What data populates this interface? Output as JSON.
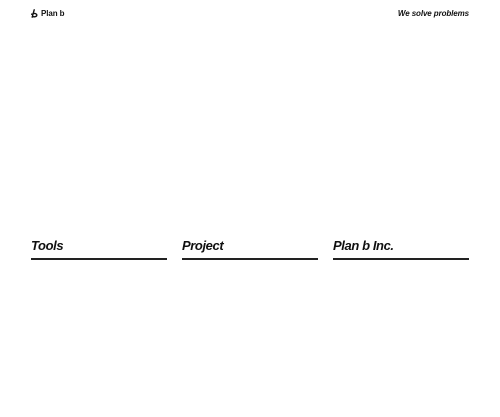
{
  "header": {
    "logo_text": "Plan b",
    "logo_icon": "hand-drawn-b-mark-icon",
    "tagline": "We solve problems"
  },
  "nav": {
    "items": [
      {
        "label": "Tools"
      },
      {
        "label": "Project"
      },
      {
        "label": "Plan b Inc."
      }
    ]
  },
  "colors": {
    "background": "#ffffff",
    "text": "#111111",
    "rule": "#222222"
  }
}
